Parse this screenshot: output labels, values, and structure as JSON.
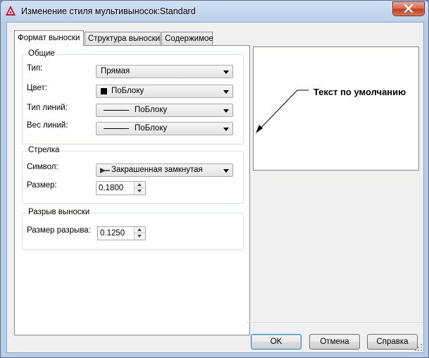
{
  "window": {
    "title": "Изменение стиля мультивыносок:Standard"
  },
  "tabs": [
    {
      "label": "Формат выноски",
      "active": true
    },
    {
      "label": "Структура выноски",
      "active": false
    },
    {
      "label": "Содержимое",
      "active": false
    }
  ],
  "general": {
    "title": "Общие",
    "type_label": "Тип:",
    "type_value": "Прямая",
    "color_label": "Цвет:",
    "color_value": "ПоБлоку",
    "linetype_label": "Тип линий:",
    "linetype_value": "ПоБлоку",
    "lineweight_label": "Вес линий:",
    "lineweight_value": "ПоБлоку"
  },
  "arrowhead": {
    "title": "Стрелка",
    "symbol_label": "Символ:",
    "symbol_value": "Закрашенная замкнутая",
    "size_label": "Размер:",
    "size_value": "0.1800"
  },
  "break": {
    "title": "Разрыв выноски",
    "size_label": "Размер разрыва:",
    "size_value": "0.1250"
  },
  "preview": {
    "text": "Текст по умолчанию"
  },
  "buttons": {
    "ok": "OK",
    "cancel": "Отмена",
    "help": "Справка"
  },
  "colors": {
    "swatch": "#000000",
    "accent": "#3c7fb1"
  }
}
